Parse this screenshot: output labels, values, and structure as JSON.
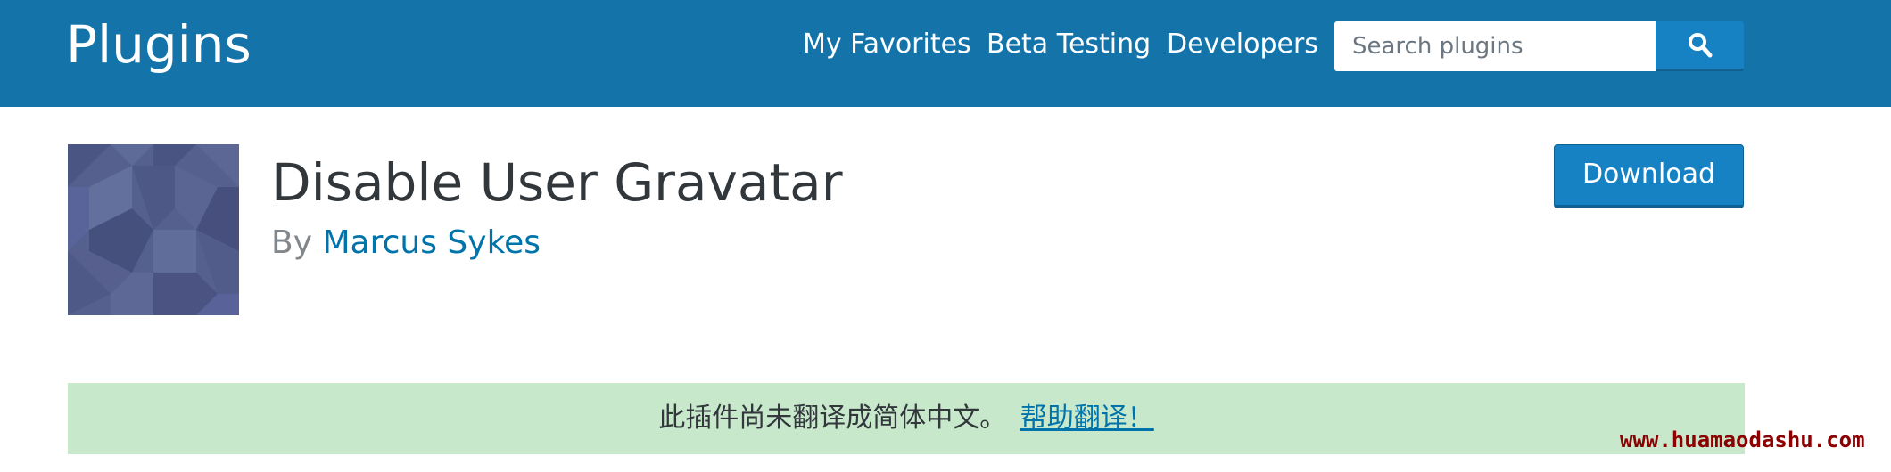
{
  "header": {
    "brand": "Plugins",
    "nav": {
      "favorites": "My Favorites",
      "beta": "Beta Testing",
      "developers": "Developers"
    },
    "search": {
      "placeholder": "Search plugins",
      "button_icon": "search-icon"
    }
  },
  "plugin": {
    "icon": "plugin-banner-icon",
    "title": "Disable User Gravatar",
    "by_label": "By",
    "author": "Marcus Sykes",
    "download_label": "Download"
  },
  "notice": {
    "text": "此插件尚未翻译成简体中文。",
    "link": "帮助翻译！"
  },
  "watermark": "www.huamaodashu.com",
  "colors": {
    "header_bg": "#1474aa",
    "accent": "#1682c4",
    "link": "#0073aa",
    "notice_bg": "#c8e8cc",
    "watermark": "#8b0000"
  }
}
